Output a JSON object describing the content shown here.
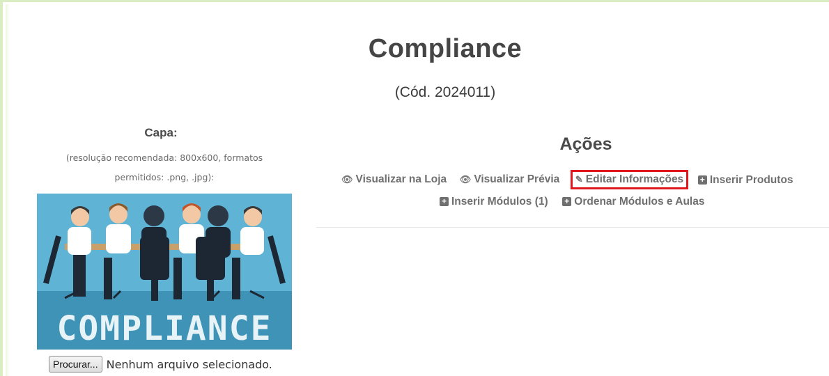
{
  "course": {
    "title": "Compliance",
    "code": "(Cód. 2024011)"
  },
  "cover": {
    "label": "Capa:",
    "hint_line1": "(resolução recomendada: 800x600, formatos",
    "hint_line2": "permitidos: .png, .jpg):",
    "image_text": "COMPLIANCE",
    "browse_button": "Procurar...",
    "file_status": "Nenhum arquivo selecionado."
  },
  "actions": {
    "title": "Ações",
    "items": [
      {
        "label": "Visualizar na Loja",
        "icon": "eye-icon"
      },
      {
        "label": "Visualizar Prévia",
        "icon": "eye-icon"
      },
      {
        "label": "Editar Informações",
        "icon": "edit-icon",
        "highlighted": true
      },
      {
        "label": "Inserir Produtos",
        "icon": "plus-square-icon"
      },
      {
        "label": "Inserir Módulos (1)",
        "icon": "plus-square-icon"
      },
      {
        "label": "Ordenar Módulos e Aulas",
        "icon": "plus-square-icon"
      }
    ]
  },
  "colors": {
    "frame_border": "#d9ecc2",
    "highlight": "#e0181e",
    "cover_background": "#5fb4d6"
  }
}
